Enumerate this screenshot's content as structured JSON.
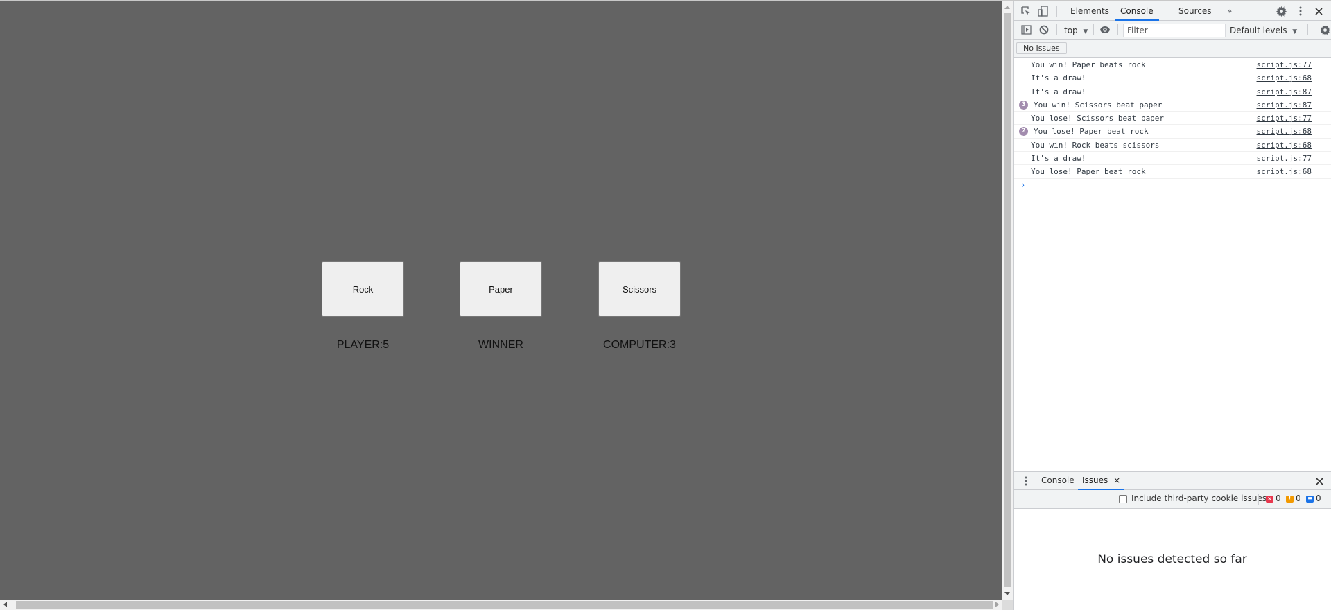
{
  "game": {
    "buttons": [
      {
        "label": "Rock"
      },
      {
        "label": "Paper"
      },
      {
        "label": "Scissors"
      }
    ],
    "player_score": "PLAYER:5",
    "winner_label": "WINNER",
    "computer_score": "COMPUTER:3"
  },
  "devtools": {
    "tabs": [
      "Elements",
      "Console",
      "Sources"
    ],
    "active_tab": "Console",
    "more_tabs_icon": "»",
    "context_select": "top",
    "filter": {
      "value": "",
      "placeholder": "Filter"
    },
    "levels_select": "Default levels",
    "no_issues_button": "No Issues",
    "console_messages": [
      {
        "text": "You win! Paper beats rock",
        "source": "script.js:77",
        "repeat": null
      },
      {
        "text": "It's a draw!",
        "source": "script.js:68",
        "repeat": null
      },
      {
        "text": "It's a draw!",
        "source": "script.js:87",
        "repeat": null
      },
      {
        "text": "You win! Scissors beat paper",
        "source": "script.js:87",
        "repeat": "3"
      },
      {
        "text": "You lose! Scissors beat paper",
        "source": "script.js:77",
        "repeat": null
      },
      {
        "text": "You lose! Paper beat rock",
        "source": "script.js:68",
        "repeat": "2"
      },
      {
        "text": "You win! Rock beats scissors",
        "source": "script.js:68",
        "repeat": null
      },
      {
        "text": "It's a draw!",
        "source": "script.js:77",
        "repeat": null
      },
      {
        "text": "You lose! Paper beat rock",
        "source": "script.js:68",
        "repeat": null
      }
    ],
    "prompt_symbol": "›",
    "drawer": {
      "tabs": [
        "Console",
        "Issues"
      ],
      "active_tab": "Issues",
      "cookie_checkbox_label": "Include third-party cookie issues",
      "cookie_checkbox_checked": false,
      "counts": {
        "errors": "0",
        "warnings": "0",
        "info": "0"
      },
      "count_colors": {
        "errors": "#e8384f",
        "warnings": "#f29900",
        "info": "#1a73e8"
      },
      "empty_message": "No issues detected so far"
    }
  }
}
